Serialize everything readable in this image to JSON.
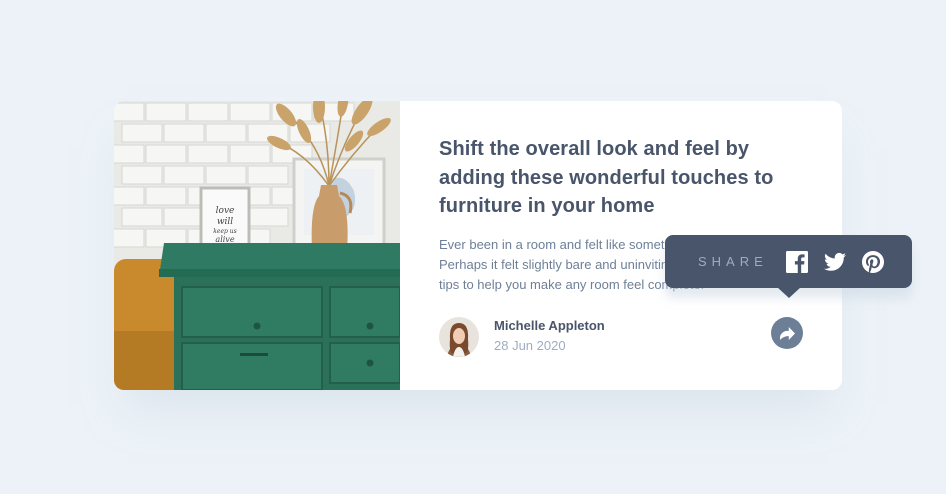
{
  "article": {
    "headline": "Shift the overall look and feel by adding these wonderful touches to furniture in your home",
    "excerpt": "Ever been in a room and felt like something was missing? Perhaps it felt slightly bare and uninviting. I've got some simple tips to help you make any room feel complete."
  },
  "author": {
    "name": "Michelle Appleton",
    "date": "28 Jun 2020"
  },
  "share": {
    "label": "SHARE",
    "icons": [
      "facebook-icon",
      "twitter-icon",
      "pinterest-icon"
    ],
    "button_icon": "share-arrow-icon"
  },
  "image": {
    "frame_text": "love will keep us alive"
  },
  "colors": {
    "background": "#ecf2f8",
    "card": "#ffffff",
    "headline": "#48556a",
    "body": "#6e8098",
    "muted": "#9dadc1",
    "tooltip": "#48556a",
    "share_button": "#6d7f97",
    "dresser": "#2e7a62"
  }
}
